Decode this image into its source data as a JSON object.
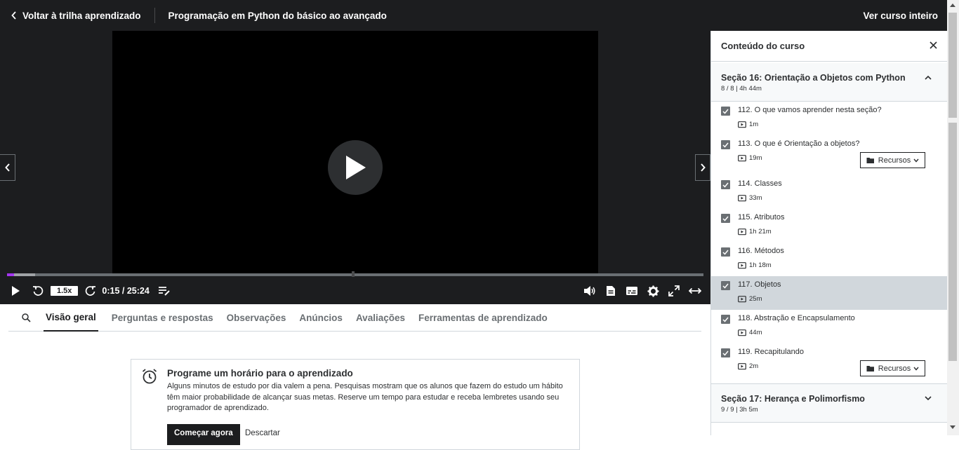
{
  "header": {
    "back_label": "Voltar à trilha aprendizado",
    "course_title": "Programação em Python do básico ao avançado",
    "view_course_label": "Ver curso inteiro"
  },
  "player": {
    "speed": "1.5x",
    "time": "0:15 / 25:24",
    "progress_played": 0.01,
    "progress_buffered": 0.04,
    "accent_color": "#a435f0"
  },
  "tabs": [
    {
      "label": "Visão geral",
      "active": true
    },
    {
      "label": "Perguntas e respostas"
    },
    {
      "label": "Observações"
    },
    {
      "label": "Anúncios"
    },
    {
      "label": "Avaliações"
    },
    {
      "label": "Ferramentas de aprendizado"
    }
  ],
  "reminder": {
    "title": "Programe um horário para o aprendizado",
    "body": "Alguns minutos de estudo por dia valem a pena. Pesquisas mostram que os alunos que fazem do estudo um hábito têm maior probabilidade de alcançar suas metas. Reserve um tempo para estudar e receba lembretes usando seu programador de aprendizado.",
    "start_label": "Começar agora",
    "dismiss_label": "Descartar"
  },
  "sidebar": {
    "title": "Conteúdo do curso",
    "sections": [
      {
        "title": "Seção 16: Orientação a Objetos com Python",
        "meta": "8 / 8 | 4h 44m",
        "lectures": [
          {
            "title": "112. O que vamos aprender nesta seção?",
            "duration": "1m"
          },
          {
            "title": "113. O que é Orientação a objetos?",
            "duration": "19m",
            "resources": "Recursos"
          },
          {
            "title": "114. Classes",
            "duration": "33m"
          },
          {
            "title": "115. Atributos",
            "duration": "1h 21m"
          },
          {
            "title": "116. Métodos",
            "duration": "1h 18m"
          },
          {
            "title": "117. Objetos",
            "duration": "25m",
            "current": true
          },
          {
            "title": "118. Abstração e Encapsulamento",
            "duration": "44m"
          },
          {
            "title": "119. Recapitulando",
            "duration": "2m",
            "resources": "Recursos"
          }
        ]
      },
      {
        "title": "Seção 17: Herança e Polimorfismo",
        "meta": "9 / 9 | 3h 5m"
      }
    ]
  }
}
